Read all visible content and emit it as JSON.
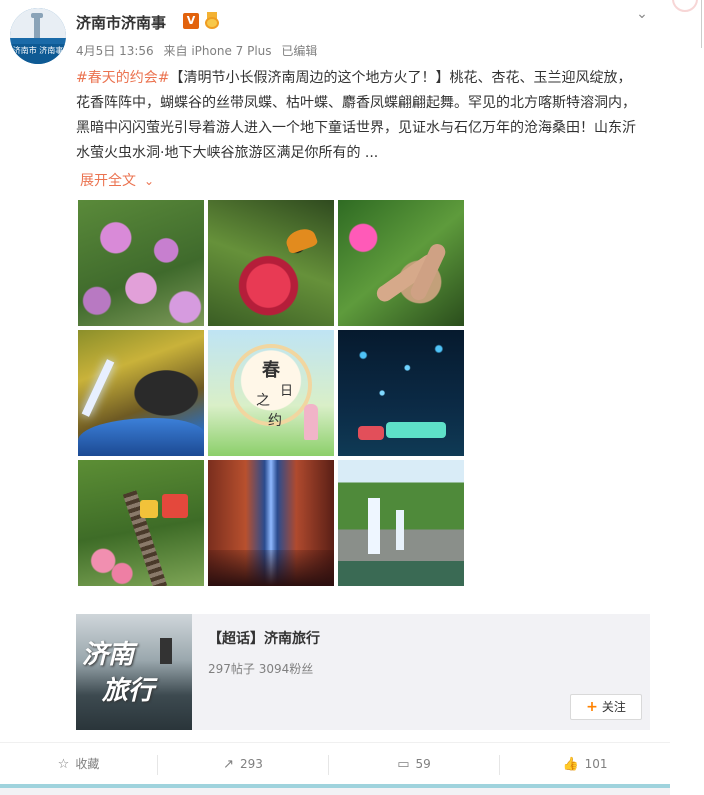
{
  "post": {
    "username": "济南市济南事",
    "verified_badge": "V",
    "avatar_text": "济南市 济南事",
    "meta": {
      "date": "4月5日 13:56",
      "source": "来自 iPhone 7 Plus",
      "edited": "已编辑"
    },
    "content": {
      "hashtag": "#春天的约会#",
      "text": "【清明节小长假济南周边的这个地方火了！】桃花、杏花、玉兰迎风绽放，花香阵阵中，蝴蝶谷的丝带凤蝶、枯叶蝶、麝香凤蝶翩翩起舞。罕见的北方喀斯特溶洞内，黑暗中闪闪萤光引导着游人进入一个地下童话世界，见证水与石亿万年的沧海桑田！山东沂水萤火虫水洞·地下大峡谷旅游区满足你所有的 ...",
      "expand_label": "展开全文"
    },
    "image_grid": {
      "poster_text": {
        "line1": "春",
        "line2": "日",
        "line3": "之",
        "line4": "约"
      }
    }
  },
  "topic_card": {
    "title": "【超话】济南旅行",
    "stats": "297帖子 3094粉丝",
    "follow_label": "关注",
    "image_text_1": "济南",
    "image_text_2": "旅行"
  },
  "actions": {
    "favorite_label": "收藏",
    "repost_count": "293",
    "comment_count": "59",
    "like_count": "101"
  },
  "icons": {
    "chevron": "chevron-down-icon",
    "favorite": "star-icon",
    "repost": "repost-icon",
    "comment": "comment-icon",
    "like": "thumbs-up-icon",
    "follow": "plus-icon"
  },
  "colors": {
    "accent": "#eb7350",
    "like": "#fa7d3c",
    "verified": "#e2620c",
    "follow_plus": "#ff8200"
  }
}
